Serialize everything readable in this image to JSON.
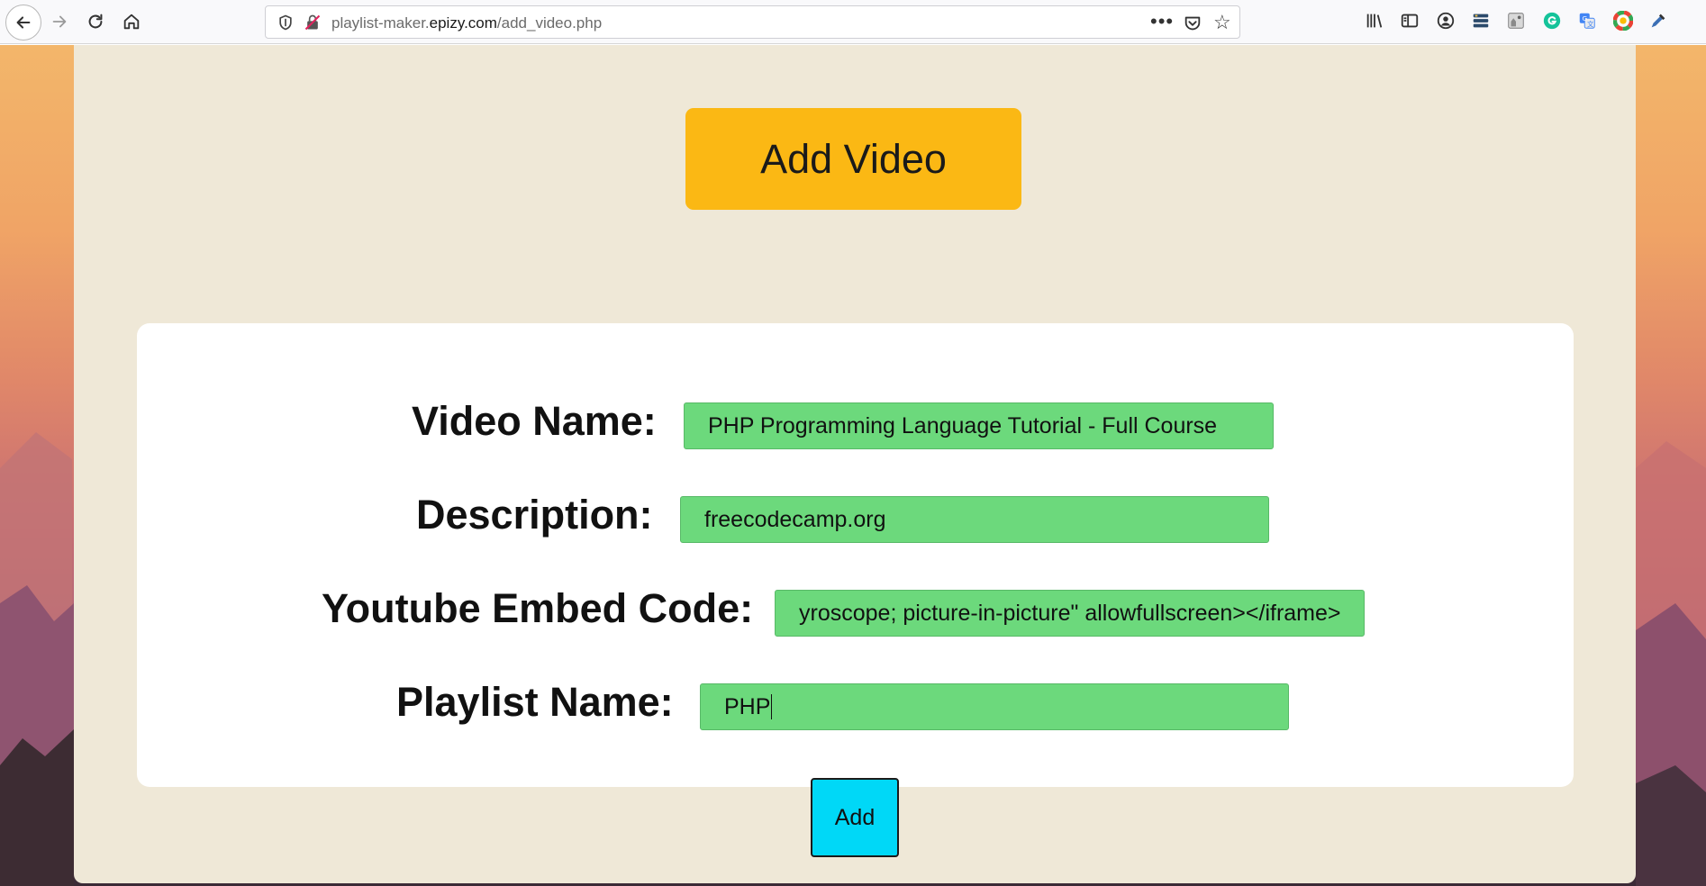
{
  "browser": {
    "url_prefix": "playlist-maker.",
    "url_domain": "epizy.com",
    "url_path": "/add_video.php",
    "more_label": "•••",
    "star_label": "☆"
  },
  "page": {
    "title": "Add Video",
    "accent_color": "#fbb814",
    "input_color": "#6cd97c",
    "button_color": "#00d8f7"
  },
  "form": {
    "fields": [
      {
        "label": "Video Name:",
        "value": "PHP Programming Language Tutorial - Full Course"
      },
      {
        "label": "Description:",
        "value": "freecodecamp.org"
      },
      {
        "label": "Youtube Embed Code:",
        "value": "yroscope; picture-in-picture\" allowfullscreen></iframe>"
      },
      {
        "label": "Playlist Name:",
        "value": "PHP"
      }
    ],
    "submit_label": "Add"
  },
  "extensions": [
    "library-icon",
    "sidebar-icon",
    "account-icon",
    "menu-extension-icon",
    "photo-extension-icon",
    "grammarly-icon",
    "translate-icon",
    "color-wheel-icon",
    "eyedropper-icon"
  ]
}
